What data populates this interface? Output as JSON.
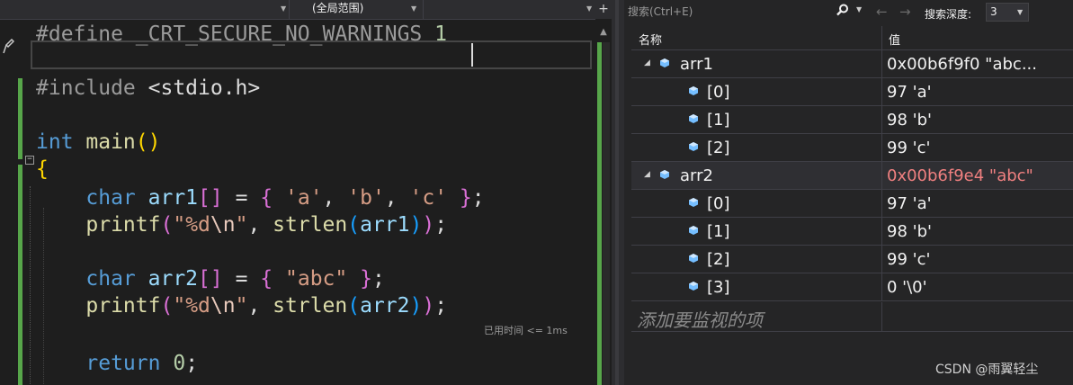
{
  "editor": {
    "scope_dropdown": "(全局范围)",
    "code_lines": [
      {
        "id": "l1",
        "tokens": [
          [
            "pp",
            "#define "
          ],
          [
            "pp",
            "_CRT_SECURE_NO_WARNINGS "
          ],
          [
            "num",
            "1"
          ]
        ]
      },
      {
        "id": "l2",
        "tokens": [
          [
            "pp",
            "#include "
          ],
          [
            "",
            "<stdio.h>"
          ]
        ]
      },
      {
        "id": "l3",
        "tokens": [
          [
            "kw",
            "int "
          ],
          [
            "fn",
            "main"
          ],
          [
            "br1",
            "()"
          ]
        ]
      },
      {
        "id": "l4",
        "tokens": [
          [
            "br1",
            "{"
          ]
        ]
      },
      {
        "id": "l5",
        "tokens": [
          [
            "",
            "    "
          ],
          [
            "kw",
            "char "
          ],
          [
            "var",
            "arr1"
          ],
          [
            "br2",
            "[]"
          ],
          [
            "",
            " = "
          ],
          [
            "br2",
            "{"
          ],
          [
            "",
            " "
          ],
          [
            "str",
            "'a'"
          ],
          [
            "",
            ", "
          ],
          [
            "str",
            "'b'"
          ],
          [
            "",
            ", "
          ],
          [
            "str",
            "'c'"
          ],
          [
            "",
            " "
          ],
          [
            "br2",
            "}"
          ],
          [
            "",
            ";"
          ]
        ]
      },
      {
        "id": "l6",
        "tokens": [
          [
            "",
            "    "
          ],
          [
            "fn",
            "printf"
          ],
          [
            "br2",
            "("
          ],
          [
            "str",
            "\"%d"
          ],
          [
            "esc",
            "\\n"
          ],
          [
            "str",
            "\""
          ],
          [
            "",
            ", "
          ],
          [
            "fn",
            "strlen"
          ],
          [
            "br3",
            "("
          ],
          [
            "var",
            "arr1"
          ],
          [
            "br3",
            ")"
          ],
          [
            "br2",
            ")"
          ],
          [
            "",
            ";"
          ]
        ]
      },
      {
        "id": "l7",
        "tokens": [
          [
            "",
            "    "
          ],
          [
            "kw",
            "char "
          ],
          [
            "var",
            "arr2"
          ],
          [
            "br2",
            "[]"
          ],
          [
            "",
            " = "
          ],
          [
            "br2",
            "{"
          ],
          [
            "",
            " "
          ],
          [
            "str",
            "\"abc\""
          ],
          [
            "",
            " "
          ],
          [
            "br2",
            "}"
          ],
          [
            "",
            ";"
          ]
        ]
      },
      {
        "id": "l8",
        "tokens": [
          [
            "",
            "    "
          ],
          [
            "fn",
            "printf"
          ],
          [
            "br2",
            "("
          ],
          [
            "str",
            "\"%d"
          ],
          [
            "esc",
            "\\n"
          ],
          [
            "str",
            "\""
          ],
          [
            "",
            ", "
          ],
          [
            "fn",
            "strlen"
          ],
          [
            "br3",
            "("
          ],
          [
            "var",
            "arr2"
          ],
          [
            "br3",
            ")"
          ],
          [
            "br2",
            ")"
          ],
          [
            "",
            ";"
          ]
        ]
      },
      {
        "id": "l9",
        "tokens": [
          [
            "",
            "    "
          ],
          [
            "kw",
            "return "
          ],
          [
            "num",
            "0"
          ],
          [
            "",
            ";"
          ]
        ]
      }
    ],
    "perf_tip": "已用时间 <= 1ms"
  },
  "watch": {
    "search_placeholder": "搜索(Ctrl+E)",
    "depth_label": "搜索深度:",
    "depth_value": "3",
    "col_name": "名称",
    "col_value": "值",
    "rows": [
      {
        "name": "arr1",
        "value": "0x00b6f9f0 \"abc...",
        "level": 0,
        "expanded": true,
        "changed": false
      },
      {
        "name": "[0]",
        "value": "97 'a'",
        "level": 1,
        "changed": false
      },
      {
        "name": "[1]",
        "value": "98 'b'",
        "level": 1,
        "changed": false
      },
      {
        "name": "[2]",
        "value": "99 'c'",
        "level": 1,
        "changed": false
      },
      {
        "name": "arr2",
        "value": "0x00b6f9e4 \"abc\"",
        "level": 0,
        "expanded": true,
        "changed": true
      },
      {
        "name": "[0]",
        "value": "97 'a'",
        "level": 1,
        "changed": false
      },
      {
        "name": "[1]",
        "value": "98 'b'",
        "level": 1,
        "changed": false
      },
      {
        "name": "[2]",
        "value": "99 'c'",
        "level": 1,
        "changed": false
      },
      {
        "name": "[3]",
        "value": "0 '\\0'",
        "level": 1,
        "changed": false
      }
    ],
    "add_item_placeholder": "添加要监视的项"
  },
  "watermark": "CSDN @雨翼轻尘",
  "colors": {
    "background": "#1e1e1e",
    "keyword": "#569cd6",
    "string": "#d69d85",
    "function": "#dcdcaa",
    "changed_value": "#f08080",
    "cube_icon": "#75beff"
  }
}
